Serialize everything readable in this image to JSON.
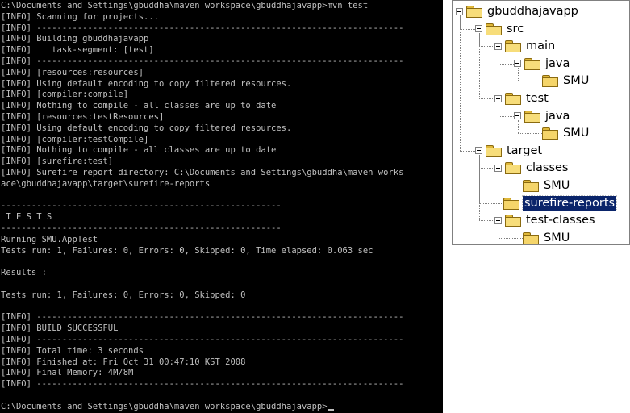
{
  "console": {
    "lines": [
      "C:\\Documents and Settings\\gbuddha\\maven_workspace\\gbuddhajavapp>mvn test",
      "[INFO] Scanning for projects...",
      "[INFO] ------------------------------------------------------------------------",
      "[INFO] Building gbuddhajavapp",
      "[INFO]    task-segment: [test]",
      "[INFO] ------------------------------------------------------------------------",
      "[INFO] [resources:resources]",
      "[INFO] Using default encoding to copy filtered resources.",
      "[INFO] [compiler:compile]",
      "[INFO] Nothing to compile - all classes are up to date",
      "[INFO] [resources:testResources]",
      "[INFO] Using default encoding to copy filtered resources.",
      "[INFO] [compiler:testCompile]",
      "[INFO] Nothing to compile - all classes are up to date",
      "[INFO] [surefire:test]",
      "[INFO] Surefire report directory: C:\\Documents and Settings\\gbuddha\\maven_works",
      "ace\\gbuddhajavapp\\target\\surefire-reports",
      "",
      "-------------------------------------------------------",
      " T E S T S",
      "-------------------------------------------------------",
      "Running SMU.AppTest",
      "Tests run: 1, Failures: 0, Errors: 0, Skipped: 0, Time elapsed: 0.063 sec",
      "",
      "Results :",
      "",
      "Tests run: 1, Failures: 0, Errors: 0, Skipped: 0",
      "",
      "[INFO] ------------------------------------------------------------------------",
      "[INFO] BUILD SUCCESSFUL",
      "[INFO] ------------------------------------------------------------------------",
      "[INFO] Total time: 3 seconds",
      "[INFO] Finished at: Fri Oct 31 00:47:10 KST 2008",
      "[INFO] Final Memory: 4M/8M",
      "[INFO] ------------------------------------------------------------------------",
      "",
      "C:\\Documents and Settings\\gbuddha\\maven_workspace\\gbuddhajavapp>"
    ],
    "colors": {
      "background": "#000000",
      "text": "#c0c0c0"
    }
  },
  "tree": {
    "nodes": [
      {
        "label": "gbuddhajavapp",
        "depth": 0,
        "expanded": true
      },
      {
        "label": "src",
        "depth": 1,
        "expanded": true
      },
      {
        "label": "main",
        "depth": 2,
        "expanded": true
      },
      {
        "label": "java",
        "depth": 3,
        "expanded": true
      },
      {
        "label": "SMU",
        "depth": 4,
        "expanded": false
      },
      {
        "label": "test",
        "depth": 2,
        "expanded": true
      },
      {
        "label": "java",
        "depth": 3,
        "expanded": true
      },
      {
        "label": "SMU",
        "depth": 4,
        "expanded": false
      },
      {
        "label": "target",
        "depth": 1,
        "expanded": true
      },
      {
        "label": "classes",
        "depth": 2,
        "expanded": true
      },
      {
        "label": "SMU",
        "depth": 3,
        "expanded": false
      },
      {
        "label": "surefire-reports",
        "depth": 2,
        "expanded": false,
        "selected": true
      },
      {
        "label": "test-classes",
        "depth": 2,
        "expanded": true
      },
      {
        "label": "SMU",
        "depth": 3,
        "expanded": false
      }
    ],
    "icon": "folder-icon",
    "colors": {
      "selection": "#0a246a",
      "selection_text": "#ffffff",
      "folder": "#f5d56a"
    }
  }
}
